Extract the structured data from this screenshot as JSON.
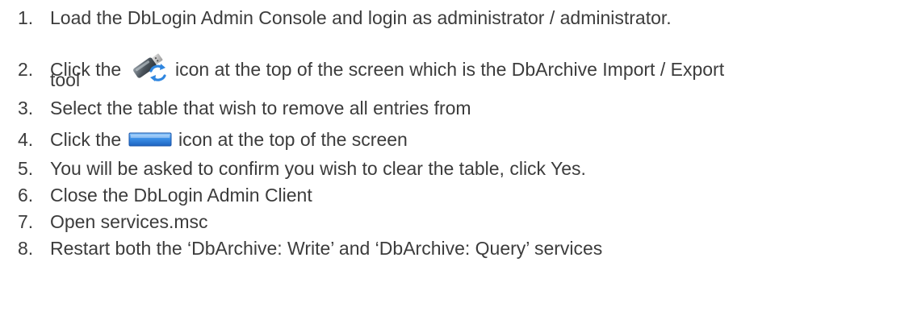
{
  "steps": [
    {
      "number": "1.",
      "text": "Load the DbLogin Admin Console and login as administrator / administrator."
    },
    {
      "number": "2.",
      "before": "Click the",
      "icon": "usb-drive-sync-icon",
      "after": "icon at the top of the screen which is the DbArchive Import / Export",
      "continuation": "tool"
    },
    {
      "number": "3.",
      "text": "Select the table that wish to remove all entries from"
    },
    {
      "number": "4.",
      "before": "Click the",
      "icon": "blue-bar-icon",
      "after": "icon at the top of the screen"
    },
    {
      "number": "5.",
      "text": "You will be asked to confirm you wish to clear the table, click Yes."
    },
    {
      "number": "6.",
      "text": "Close the DbLogin Admin Client"
    },
    {
      "number": "7.",
      "text": "Open services.msc"
    },
    {
      "number": "8.",
      "text": "Restart both the ‘DbArchive: Write’ and ‘DbArchive: Query’ services"
    }
  ],
  "colors": {
    "text": "#3c3c3c",
    "icon_blue": "#3a8ee6"
  }
}
